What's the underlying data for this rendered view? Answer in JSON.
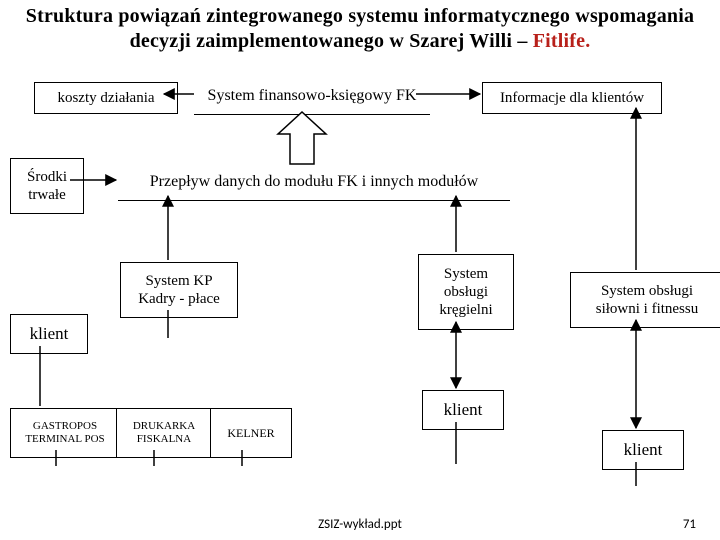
{
  "title_plain": "Struktura powiązań zintegrowanego systemu informatycznego wspomagania decyzji zaimplementowanego w Szarej Willi – ",
  "title_em": "Fitlife.",
  "nodes": {
    "koszty": "koszty działania",
    "fk": "System finansowo-księgowy FK",
    "info": "Informacje dla klientów",
    "srodki": "Środki\ntrwałe",
    "przeplyw": "Przepływ danych do modułu FK i innych modułów",
    "kp": "System KP\nKadry - płace",
    "kregle": "System\nobsługi\nkręgielni",
    "silownia": "System obsługi\nsiłowni i fitnessu",
    "klient1": "klient",
    "klient2": "klient",
    "klient3": "klient",
    "pos": "GASTROPOS\nTERMINAL POS",
    "drukarka": "DRUKARKA\nFISKALNA",
    "kelner": "KELNER"
  },
  "footer_file": "ZSIZ-wykład.ppt",
  "footer_page": "71"
}
